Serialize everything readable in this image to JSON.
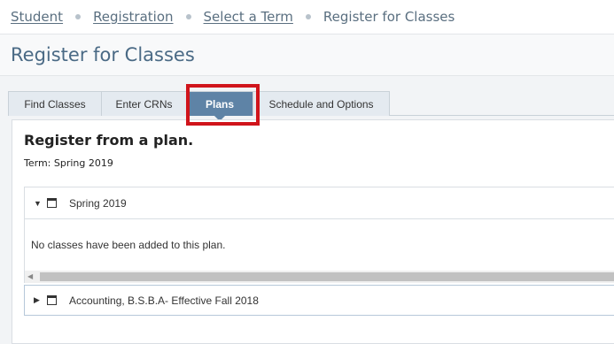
{
  "breadcrumb": {
    "items": [
      "Student",
      "Registration",
      "Select a Term"
    ],
    "current": "Register for Classes"
  },
  "page": {
    "title": "Register for Classes"
  },
  "tabs": [
    {
      "label": "Find Classes",
      "active": false
    },
    {
      "label": "Enter CRNs",
      "active": false
    },
    {
      "label": "Plans",
      "active": true
    },
    {
      "label": "Schedule and Options",
      "active": false
    }
  ],
  "panel": {
    "heading": "Register from a plan.",
    "term": "Term: Spring 2019",
    "plans": [
      {
        "name": "Spring 2019",
        "expanded": true,
        "message": "No classes have been added to this plan."
      },
      {
        "name": "Accounting, B.S.B.A- Effective Fall 2018",
        "expanded": false
      }
    ]
  },
  "icons": {
    "expanded": "caret-down-icon",
    "collapsed": "caret-right-icon",
    "plan": "calendar-icon",
    "scroll_left": "scroll-left-arrow-icon"
  },
  "colors": {
    "active_tab": "#5e83a6",
    "highlight_box": "#d0141b",
    "title": "#4a6a85",
    "link": "#5a6f80"
  }
}
